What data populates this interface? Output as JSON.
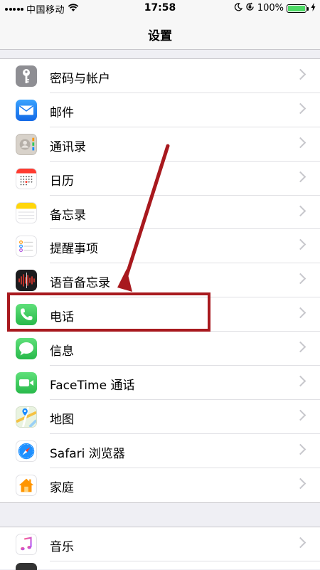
{
  "status_bar": {
    "carrier": "中国移动",
    "time": "17:58",
    "battery_percent": "100%",
    "battery_level": 1.0,
    "icons": [
      "signal-icon",
      "wifi-icon",
      "moon-icon",
      "orientation-lock-icon",
      "battery-icon",
      "charging-icon"
    ]
  },
  "nav": {
    "title": "设置"
  },
  "settings_group_1": [
    {
      "label": "密码与帐户",
      "icon": "key-icon",
      "color": "#8e8e93"
    },
    {
      "label": "邮件",
      "icon": "mail-icon",
      "color": "#1a8cff"
    },
    {
      "label": "通讯录",
      "icon": "contacts-icon",
      "color": "#d8d2ca"
    },
    {
      "label": "日历",
      "icon": "calendar-icon",
      "color": "#ffffff"
    },
    {
      "label": "备忘录",
      "icon": "notes-icon",
      "color": "#ffd60a"
    },
    {
      "label": "提醒事项",
      "icon": "reminders-icon",
      "color": "#ffffff"
    },
    {
      "label": "语音备忘录",
      "icon": "voice-memos-icon",
      "color": "#1c1c1e"
    },
    {
      "label": "电话",
      "icon": "phone-icon",
      "color": "#34c759"
    },
    {
      "label": "信息",
      "icon": "messages-icon",
      "color": "#34c759"
    },
    {
      "label": "FaceTime 通话",
      "icon": "facetime-icon",
      "color": "#34c759"
    },
    {
      "label": "地图",
      "icon": "maps-icon",
      "color": "#e9f3e0"
    },
    {
      "label": "Safari 浏览器",
      "icon": "safari-icon",
      "color": "#1e90ff"
    },
    {
      "label": "家庭",
      "icon": "home-icon",
      "color": "#ffffff"
    }
  ],
  "settings_group_2": [
    {
      "label": "音乐",
      "icon": "music-icon",
      "color": "#ffffff"
    }
  ],
  "annotation": {
    "color": "#a8191e",
    "highlight_target": "电话"
  }
}
